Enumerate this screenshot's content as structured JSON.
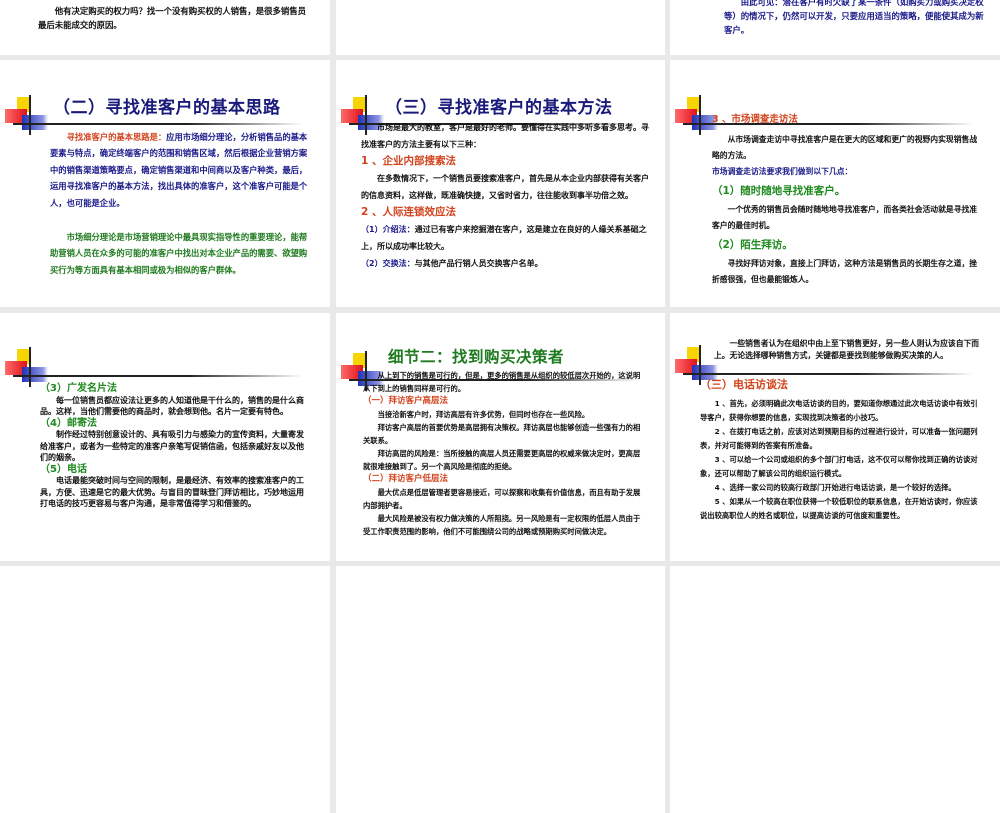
{
  "slides": [
    {
      "id": "s0",
      "cls": "c0 r0",
      "deco": false,
      "blocks": [
        {
          "kind": "ind",
          "parts": [
            {
              "k": "k-black",
              "t": "他有决定购买的权力吗？找一个没有购买权的人销售，是很多销售员最后未能成交的原因。"
            }
          ]
        }
      ]
    },
    {
      "id": "s1",
      "cls": "c1 r0",
      "deco": false,
      "blocks": []
    },
    {
      "id": "s2",
      "cls": "c2 r0",
      "deco": false,
      "blocks": [
        {
          "kind": "ind",
          "parts": [
            {
              "k": "k-blue",
              "t": "由此可见：潜在客户有时欠缺了某一条件（如购买力或购买决定权等）的情况下，仍然可以开发，只要应用适当的策略，便能使其成为新客户。"
            }
          ]
        }
      ]
    },
    {
      "id": "s3",
      "cls": "c0 r1",
      "deco": true,
      "decoTop": 35,
      "blocks": [
        {
          "kind": "title",
          "parts": [
            {
              "t": "（二）寻找准客户的基本思路"
            }
          ]
        },
        {
          "kind": "ind",
          "parts": [
            {
              "k": "k-red",
              "t": "寻找准客户的基本思路是："
            },
            {
              "k": "k-blue",
              "t": "应用市场细分理论，分析销售品的基本要素与特点，确定终端客户的范围和销售区域，然后根据企业营销方案中的销售渠道策略要点，确定销售渠道和中间商以及客户种类，最后，运用寻找准客户的基本方法，找出具体的准客户，这个准客户可能是个人，也可能是企业。"
            }
          ]
        },
        {
          "kind": "gap",
          "parts": []
        },
        {
          "kind": "ind",
          "parts": [
            {
              "k": "k-green",
              "t": "市场细分理论是市场营销理论中最具现实指导性的重要理论，能帮助营销人员在众多的可能的准客户中找出对本企业产品的需要、欲望购买行为等方面具有基本相同或极为相似的客户群体。"
            }
          ]
        }
      ]
    },
    {
      "id": "s4",
      "cls": "c1 r1",
      "deco": true,
      "decoTop": 35,
      "blocks": [
        {
          "kind": "title",
          "parts": [
            {
              "t": "（三）寻找准客户的基本方法"
            }
          ]
        },
        {
          "kind": "ind",
          "parts": [
            {
              "k": "k-black",
              "t": "市场是最大的教室，客户是最好的老师。要懂得在实践中多听多看多思考。寻找准客户的方法主要有以下三种："
            }
          ]
        },
        {
          "kind": "h-red",
          "parts": [
            {
              "t": "1 、企业内部搜索法"
            }
          ]
        },
        {
          "kind": "ind",
          "parts": [
            {
              "k": "k-black",
              "t": "在多数情况下，一个销售员要搜索准客户，首先是从本企业内部获得有关客户的信息资料，这样做，既准确快捷，又省时省力，往往能收到事半功倍之效。"
            }
          ]
        },
        {
          "kind": "h-red",
          "parts": [
            {
              "t": "2 、人际连锁效应法"
            }
          ]
        },
        {
          "kind": "p",
          "parts": [
            {
              "k": "k-blue",
              "t": "（1）介绍法："
            },
            {
              "k": "k-black",
              "t": "通过已有客户来挖掘潜在客户，这是建立在良好的人缘关系基础之上，所以成功率比较大。"
            }
          ]
        },
        {
          "kind": "p",
          "parts": [
            {
              "k": "k-blue",
              "t": "（2）交换法："
            },
            {
              "k": "k-black",
              "t": "与其他产品行销人员交换客户名单。"
            }
          ]
        }
      ]
    },
    {
      "id": "s5",
      "cls": "c2 r1",
      "deco": true,
      "decoTop": 35,
      "blocks": [
        {
          "kind": "h-red",
          "parts": [
            {
              "t": "3 、市场调查走访法"
            }
          ]
        },
        {
          "kind": "ind",
          "parts": [
            {
              "k": "k-black",
              "t": "从市场调查走访中寻找准客户是在更大的区域和更广的视野内实现销售战略的方法。"
            }
          ]
        },
        {
          "kind": "p",
          "parts": [
            {
              "k": "k-blue",
              "t": "  市场调查走访法要求我们做到以下几点："
            }
          ]
        },
        {
          "kind": "h-green",
          "parts": [
            {
              "t": "（1）随时随地寻找准客户。"
            }
          ]
        },
        {
          "kind": "ind",
          "parts": [
            {
              "k": "k-black",
              "t": "一个优秀的销售员会随时随地地寻找准客户，而各类社会活动就是寻找准客户的最佳时机。"
            }
          ]
        },
        {
          "kind": "h-green",
          "parts": [
            {
              "t": "（2）陌生拜访。"
            }
          ]
        },
        {
          "kind": "ind",
          "parts": [
            {
              "k": "k-black",
              "t": "寻找好拜访对象，直接上门拜访，这种方法是销售员的长期生存之道，挫折感很强，但也最能锻炼人。"
            }
          ]
        }
      ]
    },
    {
      "id": "s6",
      "cls": "c0 r2",
      "deco": true,
      "decoTop": 34,
      "blocks": [
        {
          "kind": "h-green",
          "parts": [
            {
              "t": "（3）广发名片法"
            }
          ]
        },
        {
          "kind": "ind",
          "parts": [
            {
              "k": "k-black",
              "t": "每一位销售员都应设法让更多的人知道他是干什么的，销售的是什么商品。这样，当他们需要他的商品时，就会想到他。名片一定要有特色。"
            }
          ]
        },
        {
          "kind": "h-green",
          "parts": [
            {
              "t": "（4）邮寄法"
            }
          ]
        },
        {
          "kind": "ind",
          "parts": [
            {
              "k": "k-black",
              "t": "制作经过特别创意设计的、具有吸引力与感染力的宣传资料，大量寄发给准客户，或者为一些特定的准客户亲笔写促销信函，包括亲戚好友以及他们的姻亲。"
            }
          ]
        },
        {
          "kind": "h-green",
          "parts": [
            {
              "t": "（5）电话"
            }
          ]
        },
        {
          "kind": "ind",
          "parts": [
            {
              "k": "k-black",
              "t": "电话最能突破时间与空间的限制，是最经济、有效率的搜索准客户的工具，方便、迅速是它的最大优势。与盲目的冒昧登门拜访相比，巧妙地运用打电话的技巧更容易与客户沟通，是非常值得学习和借鉴的。"
            }
          ]
        }
      ]
    },
    {
      "id": "s7",
      "cls": "c1 r2",
      "deco": true,
      "decoTop": 38,
      "blocks": [
        {
          "kind": "title green",
          "parts": [
            {
              "t": "细节二：找到购买决策者"
            }
          ]
        },
        {
          "kind": "ind",
          "parts": [
            {
              "k": "k-black",
              "t": "从上到下的销售是可行的，但是，更多的销售是从组织的较低层次开始的，这说明从下到上的销售同样是可行的。"
            }
          ]
        },
        {
          "kind": "h-red",
          "parts": [
            {
              "t": "（一）拜访客户高层法"
            }
          ]
        },
        {
          "kind": "ind",
          "parts": [
            {
              "k": "k-black",
              "t": "当接洽新客户时，拜访高层有许多优势，但同时也存在一些风险。"
            }
          ]
        },
        {
          "kind": "ind",
          "parts": [
            {
              "k": "k-black",
              "t": "拜访客户高层的首要优势是高层拥有决策权。拜访高层也能够创造一些强有力的相关联系。"
            }
          ]
        },
        {
          "kind": "ind",
          "parts": [
            {
              "k": "k-black",
              "t": "拜访高层的风险是：当所接触的高层人员还需要更高层的权威来做决定时，更高层就很难接触到了。另一个高风险是彻底的拒绝。"
            }
          ]
        },
        {
          "kind": "h-red",
          "parts": [
            {
              "t": "（二）拜访客户低层法"
            }
          ]
        },
        {
          "kind": "ind",
          "parts": [
            {
              "k": "k-black",
              "t": "最大优点是低层管理者更容易接近，可以探察和收集有价值信息，而且有助于发展内部拥护者。"
            }
          ]
        },
        {
          "kind": "ind",
          "parts": [
            {
              "k": "k-black",
              "t": "最大风险是被没有权力做决策的人所阻挠。另一风险是有一定权限的低层人员由于受工作职责范围的影响，他们不可能围绕公司的战略或预期购买时间做决定。"
            }
          ]
        }
      ]
    },
    {
      "id": "s8",
      "cls": "c2 r2",
      "deco": true,
      "decoTop": 32,
      "blocks": [
        {
          "kind": "lead ind",
          "parts": [
            {
              "k": "k-black",
              "t": "一些销售者认为在组织中由上至下销售更好，另一些人则认为应该自下而上。无论选择哪种销售方式，关键都是要找到能够做购买决策的人。"
            }
          ]
        },
        {
          "kind": "h-red",
          "parts": [
            {
              "t": "（三）电话访谈法"
            }
          ]
        },
        {
          "kind": "ind",
          "parts": [
            {
              "k": "k-black",
              "t": "1 、首先，必须明确此次电话访谈的目的，要知道你想通过此次电话访谈中有效引导客户，获得你想要的信息，实现找到决策者的小技巧。"
            }
          ]
        },
        {
          "kind": "ind",
          "parts": [
            {
              "k": "k-black",
              "t": "2 、在拨打电话之前，应该对达到预期目标的过程进行设计，可以准备一张问题列表，并对可能得到的答案有所准备。"
            }
          ]
        },
        {
          "kind": "ind",
          "parts": [
            {
              "k": "k-black",
              "t": "3 、可以给一个公司或组织的多个部门打电话，这不仅可以帮你找到正确的访谈对象，还可以帮助了解该公司的组织运行模式。"
            }
          ]
        },
        {
          "kind": "ind",
          "parts": [
            {
              "k": "k-black",
              "t": "4 、选择一家公司的较高行政部门开始进行电话访谈，是一个较好的选择。"
            }
          ]
        },
        {
          "kind": "ind",
          "parts": [
            {
              "k": "k-black",
              "t": "5 、如果从一个较高在职位获得一个较低职位的联系信息，在开始访谈时，你应该说出较高职位人的姓名或职位，以提高访谈的可信度和重要性。"
            }
          ]
        }
      ]
    },
    {
      "id": "s9",
      "cls": "c0 r3",
      "deco": false,
      "blocks": []
    },
    {
      "id": "s10",
      "cls": "c1 r3",
      "deco": false,
      "blocks": []
    },
    {
      "id": "s11",
      "cls": "c2 r3",
      "deco": false,
      "blocks": []
    }
  ]
}
